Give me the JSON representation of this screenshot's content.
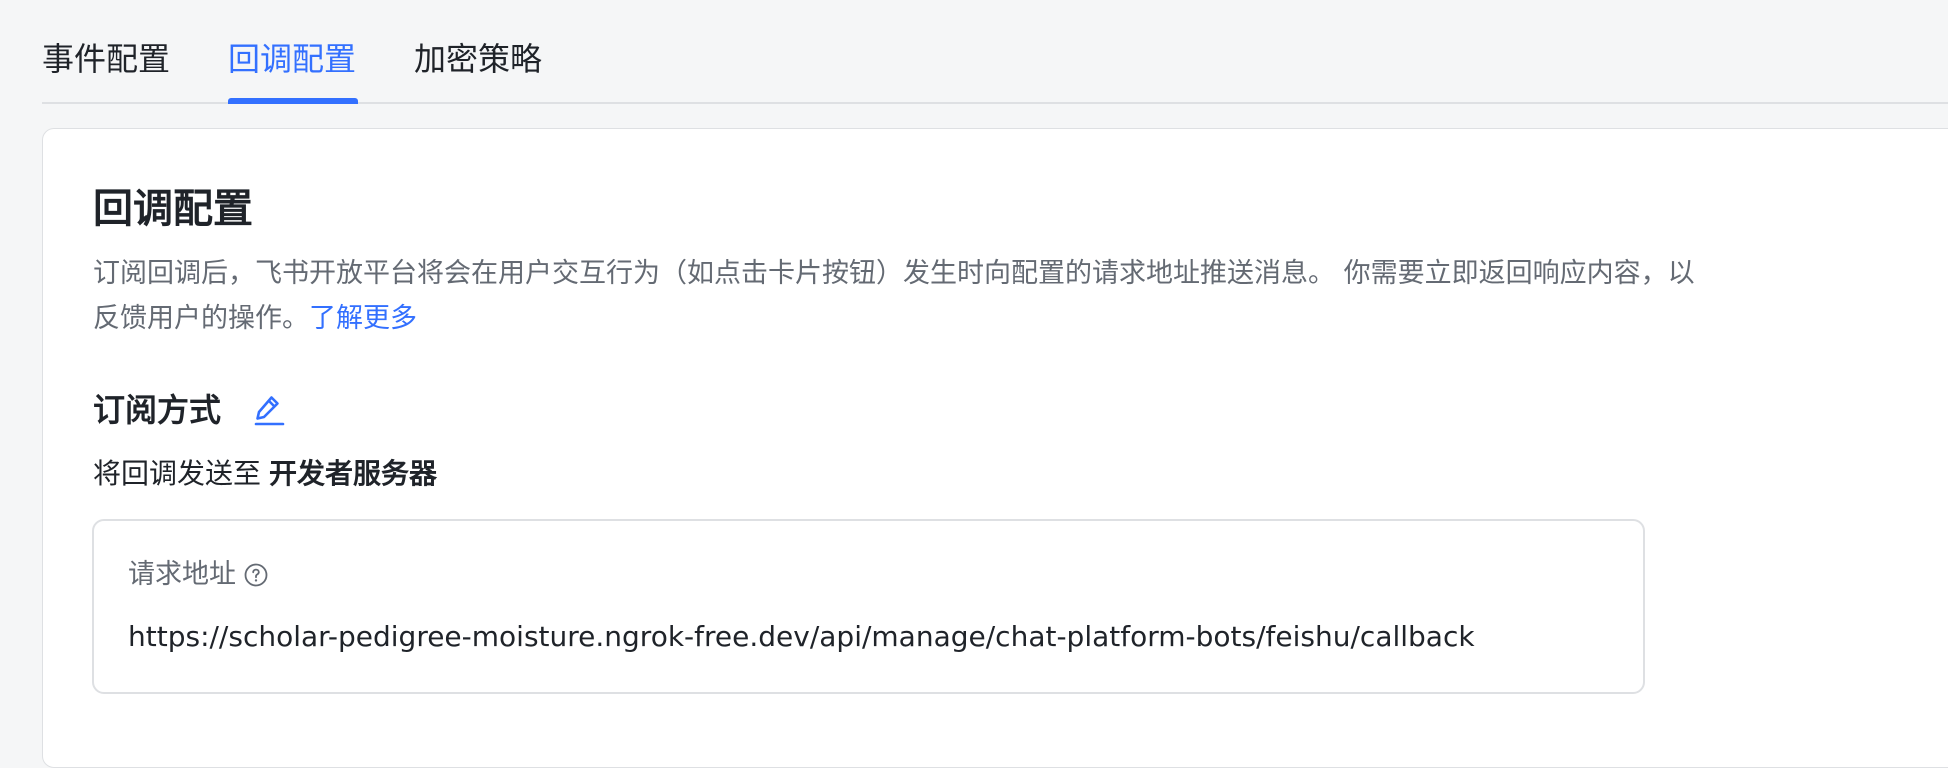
{
  "tabs": [
    {
      "label": "事件配置",
      "active": false
    },
    {
      "label": "回调配置",
      "active": true
    },
    {
      "label": "加密策略",
      "active": false
    }
  ],
  "card": {
    "title": "回调配置",
    "description": "订阅回调后，飞书开放平台将会在用户交互行为（如点击卡片按钮）发生时向配置的请求地址推送消息。 你需要立即返回响应内容，以反馈用户的操作。",
    "learn_more": "了解更多"
  },
  "subscription": {
    "title": "订阅方式",
    "edit_icon": "edit-icon",
    "send_prefix": "将回调发送至",
    "send_target": "开发者服务器"
  },
  "request_url": {
    "label": "请求地址",
    "help_icon": "question-circle-icon",
    "value": "https://scholar-pedigree-moisture.ngrok-free.dev/api/manage/chat-platform-bots/feishu/callback"
  },
  "colors": {
    "accent": "#3370ff",
    "text_primary": "#1f2329",
    "text_secondary": "#646a73",
    "border": "#dee0e3",
    "page_bg": "#f5f6f7"
  }
}
